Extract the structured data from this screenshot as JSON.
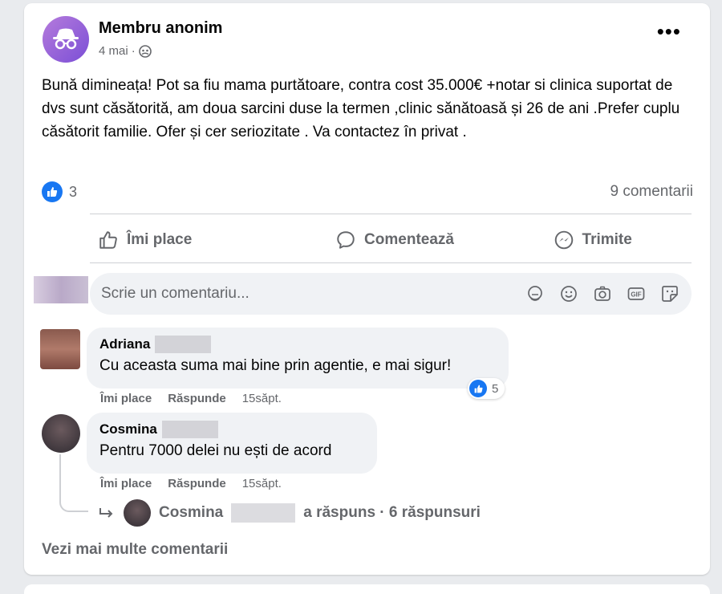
{
  "post": {
    "author": "Membru anonim",
    "date": "4 mai",
    "separator": "·",
    "text": "Bună dimineața! Pot sa fiu mama purtătoare, contra cost 35.000€ +notar si clinica suportat de dvs sunt căsătorită,  am doua sarcini duse la termen ,clinic sănătoasă și 26 de ani .Prefer cuplu căsătorit familie. Ofer și cer seriozitate . Va contactez în privat .",
    "like_count": "3",
    "comment_count": "9 comentarii"
  },
  "actions": {
    "like": "Îmi place",
    "comment": "Comentează",
    "share": "Trimite"
  },
  "comment_box": {
    "placeholder": "Scrie un comentariu..."
  },
  "comments": [
    {
      "name": "Adriana",
      "text": "Cu aceasta suma mai bine prin agentie, e mai sigur!",
      "like": "Îmi place",
      "reply": "Răspunde",
      "time": "15săpt.",
      "reactions": "5"
    },
    {
      "name": "Cosmina",
      "text": "Pentru 7000 delei nu ești de acord",
      "like": "Îmi place",
      "reply": "Răspunde",
      "time": "15săpt."
    }
  ],
  "replies": {
    "name": "Cosmina",
    "text": "a răspuns · 6 răspunsuri"
  },
  "see_more": "Vezi mai multe comentarii",
  "colors": {
    "accent": "#1877f2",
    "secondary_text": "#65676b",
    "bubble": "#f0f2f5"
  }
}
